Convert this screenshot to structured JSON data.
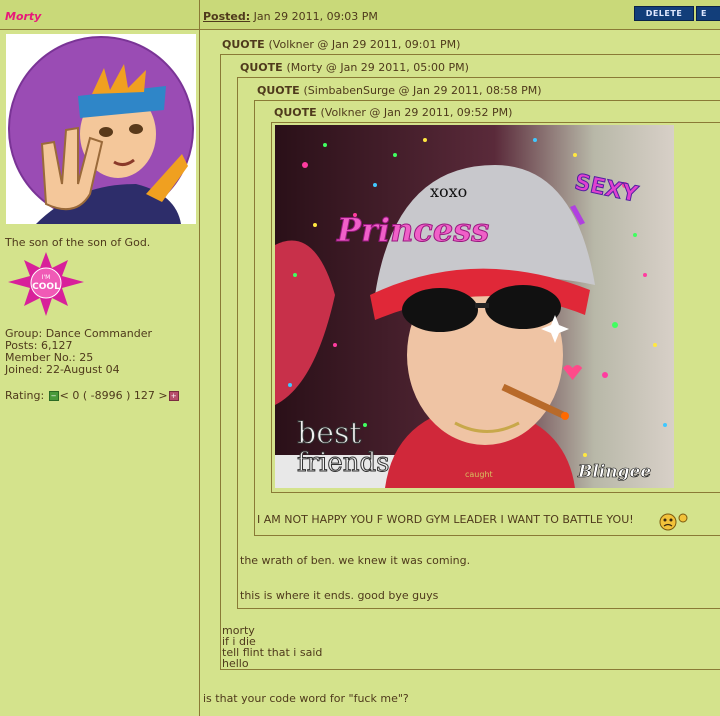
{
  "header": {
    "author": "Morty",
    "posted_label": "Posted:",
    "posted_date": "Jan 29 2011, 09:03 PM",
    "delete_label": "DELETE",
    "edit_label": "E"
  },
  "profile": {
    "member_title": "The son of the son of God.",
    "badge_text_top": "I'M",
    "badge_text_bottom": "COOL",
    "stats": [
      "Group: Dance Commander",
      "Posts: 6,127",
      "Member No.: 25",
      "Joined: 22-August 04"
    ],
    "rating_label": "Rating:",
    "rating_text": "< 0 ( -8996 ) 127 >"
  },
  "quotes": {
    "q1": {
      "label": "QUOTE",
      "meta": "(Volkner @ Jan 29 2011, 09:01 PM)"
    },
    "q2": {
      "label": "QUOTE",
      "meta": "(Morty @ Jan 29 2011, 05:00 PM)"
    },
    "q3": {
      "label": "QUOTE",
      "meta": "(SimbabenSurge @ Jan 29 2011, 08:58 PM)"
    },
    "q4": {
      "label": "QUOTE",
      "meta": "(Volkner @ Jan 29 2011, 09:52 PM)"
    }
  },
  "image": {
    "xoxo": "xoxo",
    "sexy": "SEXY",
    "princess": "Princess",
    "best": "best",
    "friends": "friends",
    "blingee": "Blingee",
    "belt_text": "caught"
  },
  "texts": {
    "q3_reply": "I AM NOT HAPPY YOU F WORD GYM LEADER I WANT TO BATTLE YOU!",
    "q2_reply_1": "the wrath of ben. we knew it was coming.",
    "q2_reply_2": "this is where it ends. good bye guys",
    "q1_reply": [
      "morty",
      "if i die",
      "tell flint that i said",
      "hello"
    ],
    "post_reply": "is that your code word for \"fuck me\"?"
  },
  "colors": {
    "page_bg": "#d4e38c",
    "author_pink": "#e8197a",
    "text_brown": "#4f3a1c",
    "border": "#8a7a36",
    "button_navy": "#123e7a"
  }
}
